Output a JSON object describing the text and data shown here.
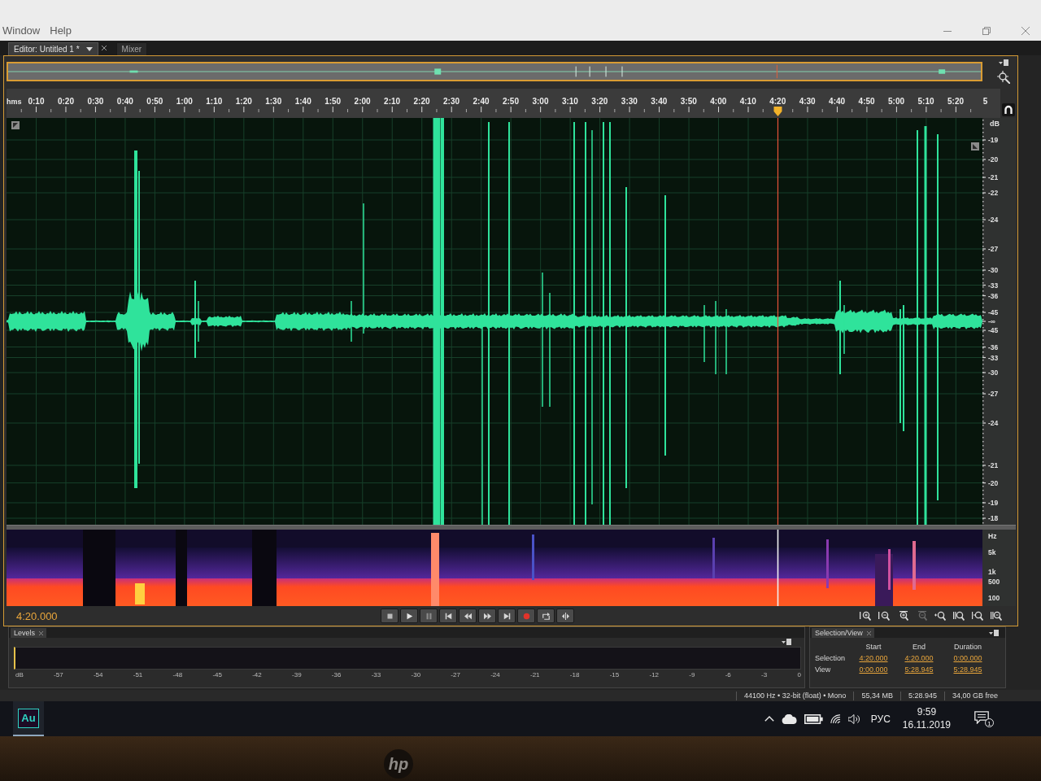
{
  "menu": [
    {
      "label": "Window"
    },
    {
      "label": "Help"
    }
  ],
  "tabs": [
    {
      "label": "Editor: Untitled 1 *",
      "selected": true,
      "dropdown": true,
      "closable": true
    },
    {
      "label": "Mixer",
      "selected": false,
      "dropdown": false,
      "closable": false
    }
  ],
  "ruler": {
    "unit": "hms",
    "labels": [
      "0:10",
      "0:20",
      "0:30",
      "0:40",
      "0:50",
      "1:00",
      "1:10",
      "1:20",
      "1:30",
      "1:40",
      "1:50",
      "2:00",
      "2:10",
      "2:20",
      "2:30",
      "2:40",
      "2:50",
      "3:00",
      "3:10",
      "3:20",
      "3:30",
      "3:40",
      "3:50",
      "4:00",
      "4:10",
      "4:20",
      "4:30",
      "4:40",
      "4:50",
      "5:00",
      "5:10",
      "5:20",
      "5"
    ]
  },
  "db_scale": {
    "unit": "dB",
    "labels": [
      "-19",
      "-20",
      "-21",
      "-22",
      "-24",
      "-27",
      "-30",
      "-33",
      "-36",
      "-45",
      "-∞",
      "-45",
      "-36",
      "-33",
      "-30",
      "-27",
      "-24",
      "-21",
      "-20",
      "-19",
      "-18"
    ]
  },
  "spectral_scale": {
    "unit": "Hz",
    "labels": [
      "5k",
      "1k",
      "500",
      "100"
    ]
  },
  "time_display": "4:20.000",
  "zoom_buttons": [
    {
      "disabled": false
    },
    {
      "disabled": false
    },
    {
      "disabled": false
    },
    {
      "disabled": true
    },
    {
      "disabled": false
    },
    {
      "disabled": false
    },
    {
      "disabled": false
    },
    {
      "disabled": false
    }
  ],
  "levels": {
    "title": "Levels",
    "scale": [
      "dB",
      "-57",
      "-54",
      "-51",
      "-48",
      "-45",
      "-42",
      "-39",
      "-36",
      "-33",
      "-30",
      "-27",
      "-24",
      "-21",
      "-18",
      "-15",
      "-12",
      "-9",
      "-6",
      "-3",
      "0"
    ]
  },
  "selection_view": {
    "title": "Selection/View",
    "columns": [
      "Start",
      "End",
      "Duration"
    ],
    "rows": [
      {
        "label": "Selection",
        "values": [
          "4:20.000",
          "4:20.000",
          "0:00.000"
        ]
      },
      {
        "label": "View",
        "values": [
          "0:00.000",
          "5:28.945",
          "5:28.945"
        ]
      }
    ]
  },
  "status_bar": [
    "44100 Hz • 32-bit (float) • Mono",
    "55,34 MB",
    "5:28.945",
    "34,00 GB free"
  ],
  "taskbar": {
    "apps": [
      {
        "label": "Au",
        "active": true
      }
    ],
    "language": "РУС",
    "time": "9:59",
    "date": "16.11.2019",
    "notifications": "1"
  },
  "monitor": {
    "logo": "hp"
  }
}
